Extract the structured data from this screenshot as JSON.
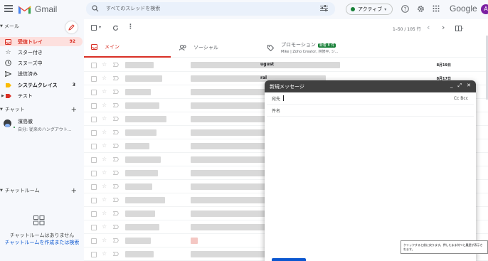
{
  "app": {
    "name": "Gmail"
  },
  "search": {
    "placeholder": "すべてのスレッドを検索"
  },
  "status": {
    "label": "アクティブ",
    "color": "#188038"
  },
  "brand": {
    "google": "Google",
    "avatar_letter": "A"
  },
  "sidebar": {
    "mail_header": "メール",
    "items": [
      {
        "label": "受信トレイ",
        "count": "92",
        "icon": "inbox-icon"
      },
      {
        "label": "スター付き",
        "count": "",
        "icon": "star-icon"
      },
      {
        "label": "スヌーズ中",
        "count": "",
        "icon": "clock-icon"
      },
      {
        "label": "送信済み",
        "count": "",
        "icon": "send-icon"
      },
      {
        "label": "システムクレイス",
        "count": "3",
        "icon": "label-icon"
      },
      {
        "label": "テスト",
        "count": "",
        "icon": "label-icon"
      }
    ],
    "chat_header": "チャット",
    "chat_user": {
      "name": "濱島徹",
      "status": "自分: 従来のハングアウト..."
    },
    "rooms_header": "チャットルーム",
    "no_rooms": "チャットルームはありません",
    "create_room": "チャットルームを作成または検索"
  },
  "toolbar": {
    "pagination": "1–50 / 105 行"
  },
  "tabs": [
    {
      "label": "メイン",
      "icon": "inbox-tab-icon"
    },
    {
      "label": "ソーシャル",
      "icon": "people-icon"
    },
    {
      "label": "プロモーション",
      "icon": "tag-icon",
      "badge": "新着 8 件",
      "sub": "Mike | Zoho Creator, 林修平, ジ..."
    }
  ],
  "rows": [
    {
      "subject": "ugust",
      "date": "8月19日"
    },
    {
      "subject": "ral",
      "date": "8月17日"
    },
    {
      "subject": "",
      "date": ""
    },
    {
      "subject": "",
      "date": ""
    },
    {
      "subject": "",
      "date": ""
    },
    {
      "subject": "",
      "date": ""
    },
    {
      "subject": "",
      "date": ""
    },
    {
      "subject": "",
      "date": ""
    },
    {
      "subject": "",
      "date": ""
    },
    {
      "subject": "",
      "date": ""
    },
    {
      "subject": "",
      "date": ""
    },
    {
      "subject": "",
      "date": ""
    },
    {
      "subject": "",
      "date": ""
    },
    {
      "subject": "",
      "date": ""
    },
    {
      "subject": "",
      "date": ""
    }
  ],
  "compose": {
    "title": "新規メッセージ",
    "to_label": "宛先",
    "cc_bcc": "Cc Bcc",
    "subject_label": "件名"
  },
  "tooltip": {
    "text": "クリックすると前に戻ります。押したまま待つと履歴が表示されます。"
  }
}
